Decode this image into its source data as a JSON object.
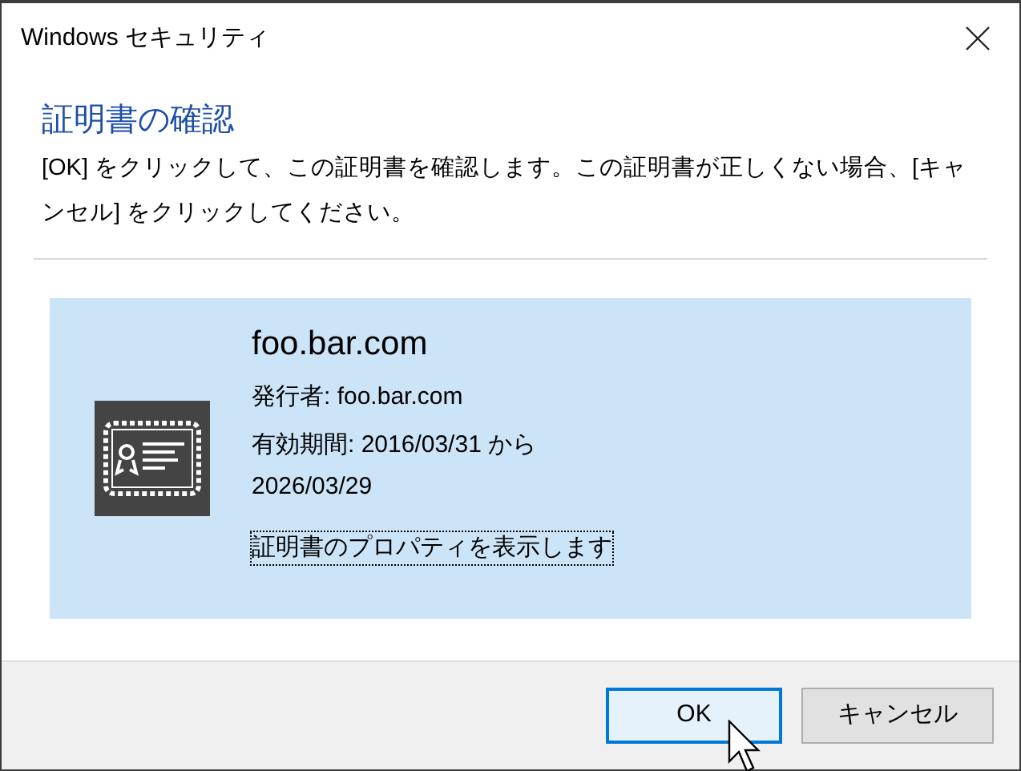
{
  "window": {
    "title": "Windows セキュリティ"
  },
  "heading": "証明書の確認",
  "message": "[OK] をクリックして、この証明書を確認します。この証明書が正しくない場合、[キャンセル] をクリックしてください。",
  "certificate": {
    "name": "foo.bar.com",
    "issuer": "発行者: foo.bar.com",
    "validity": "有効期間: 2016/03/31 から 2026/03/29",
    "link": {
      "label": "証明書のプロパティを表示します",
      "focused": true
    }
  },
  "buttons": [
    {
      "label": "OK",
      "default": true
    },
    {
      "label": "キャンセル",
      "default": false
    }
  ]
}
